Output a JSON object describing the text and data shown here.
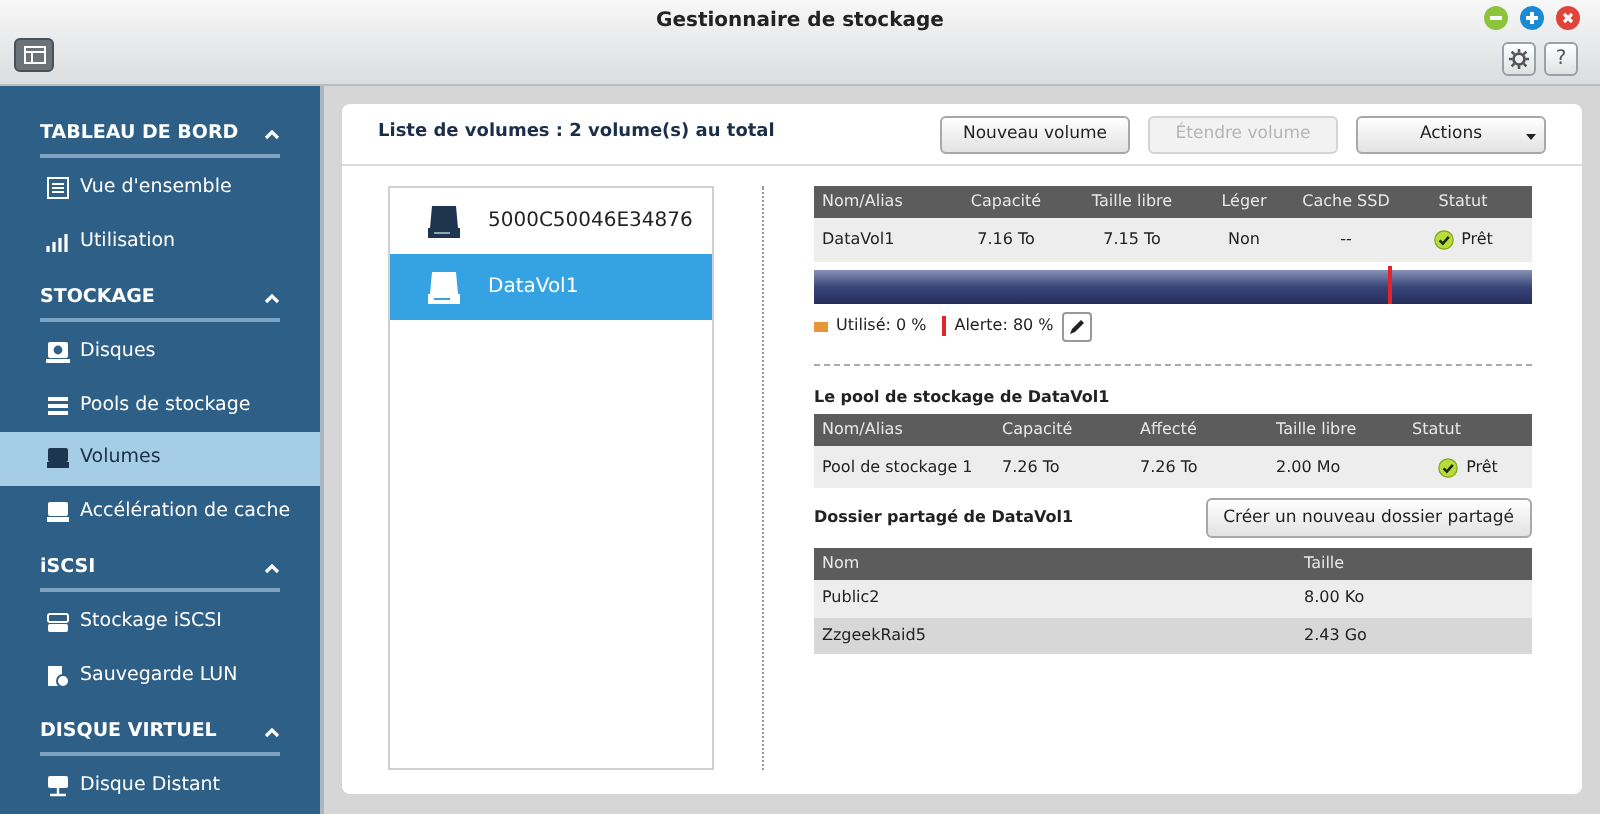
{
  "window": {
    "title": "Gestionnaire de stockage",
    "help_label": "?"
  },
  "sidebar": {
    "sections": [
      {
        "title": "TABLEAU DE BORD",
        "expanded": true,
        "items": [
          {
            "label": "Vue d'ensemble",
            "kind": "overview",
            "selected": false
          },
          {
            "label": "Utilisation",
            "kind": "chart",
            "selected": false
          }
        ]
      },
      {
        "title": "STOCKAGE",
        "expanded": true,
        "items": [
          {
            "label": "Disques",
            "kind": "disk",
            "selected": false
          },
          {
            "label": "Pools de stockage",
            "kind": "pool",
            "selected": false
          },
          {
            "label": "Volumes",
            "kind": "volume",
            "selected": true
          },
          {
            "label": "Accélération de cache",
            "kind": "cache",
            "selected": false
          }
        ]
      },
      {
        "title": "iSCSI",
        "expanded": true,
        "items": [
          {
            "label": "Stockage iSCSI",
            "kind": "iscsi",
            "selected": false
          },
          {
            "label": "Sauvegarde LUN",
            "kind": "backup",
            "selected": false
          }
        ]
      },
      {
        "title": "DISQUE VIRTUEL",
        "expanded": true,
        "items": [
          {
            "label": "Disque Distant",
            "kind": "remote",
            "selected": false
          }
        ]
      }
    ]
  },
  "panel": {
    "title": "Liste de volumes : 2 volume(s) au total",
    "buttons": [
      {
        "label": "Nouveau volume",
        "kind": "plain",
        "disabled": false
      },
      {
        "label": "Étendre volume",
        "kind": "plain",
        "disabled": true
      },
      {
        "label": "Actions",
        "kind": "dropdown",
        "disabled": false
      }
    ],
    "volumes": [
      {
        "label": "5000C50046E34876",
        "selected": false
      },
      {
        "label": "DataVol1",
        "selected": true
      }
    ],
    "volume_table": {
      "columns": [
        "Nom/Alias",
        "Capacité",
        "Taille libre",
        "Léger",
        "Cache SSD",
        "Statut"
      ],
      "rows": [
        [
          "DataVol1",
          "7.16 To",
          "7.15 To",
          "Non",
          "--",
          "Prêt"
        ]
      ]
    },
    "usage_bar": {
      "level": 0,
      "alert": {
        "level": 0.8
      }
    },
    "legend": {
      "used": "Utilisé: 0 %",
      "alert": "Alerte: 80 %"
    },
    "pool_title": "Le pool de stockage de DataVol1",
    "pool_table": {
      "columns": [
        "Nom/Alias",
        "Capacité",
        "Affecté",
        "Taille libre",
        "Statut"
      ],
      "rows": [
        [
          "Pool de stockage 1",
          "7.26 To",
          "7.26 To",
          "2.00 Mo",
          "Prêt"
        ]
      ]
    },
    "shared_title": "Dossier partagé de DataVol1",
    "shared_button": "Créer un nouveau dossier partagé",
    "shared_table": {
      "columns": [
        "Nom",
        "Taille"
      ],
      "rows": [
        [
          "Public2",
          "8.00 Ko"
        ],
        [
          "ZzgeekRaid5",
          "2.43 Go"
        ]
      ]
    }
  }
}
